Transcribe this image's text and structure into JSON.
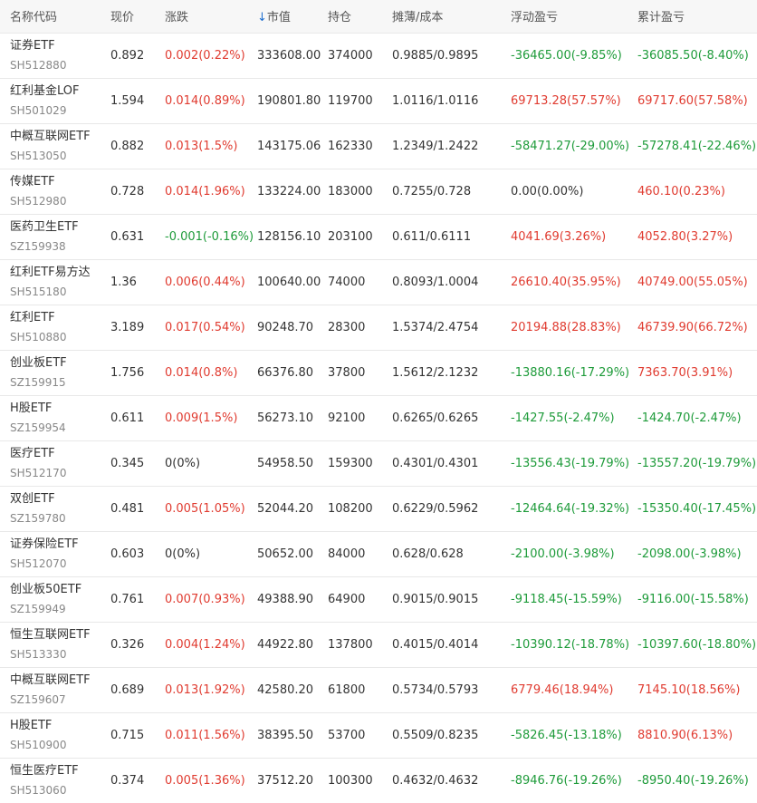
{
  "colors": {
    "up": "#e03b30",
    "down": "#1e9b3a",
    "flat": "#333333",
    "sort_arrow": "#1f6fd0"
  },
  "headers": {
    "name": "名称代码",
    "price": "现价",
    "change": "涨跌",
    "sort_arrow": "↓",
    "market_value": "市值",
    "position": "持仓",
    "cost": "摊薄/成本",
    "float_pl": "浮动盈亏",
    "total_pl": "累计盈亏"
  },
  "rows": [
    {
      "name": "证券ETF",
      "code": "SH512880",
      "price": "0.892",
      "change": "0.002(0.22%)",
      "change_dir": "up",
      "market_value": "333608.00",
      "position": "374000",
      "cost": "0.9885/0.9895",
      "float_pl": "-36465.00(-9.85%)",
      "float_dir": "down",
      "total_pl": "-36085.50(-8.40%)",
      "total_dir": "down"
    },
    {
      "name": "红利基金LOF",
      "code": "SH501029",
      "price": "1.594",
      "change": "0.014(0.89%)",
      "change_dir": "up",
      "market_value": "190801.80",
      "position": "119700",
      "cost": "1.0116/1.0116",
      "float_pl": "69713.28(57.57%)",
      "float_dir": "up",
      "total_pl": "69717.60(57.58%)",
      "total_dir": "up"
    },
    {
      "name": "中概互联网ETF",
      "code": "SH513050",
      "price": "0.882",
      "change": "0.013(1.5%)",
      "change_dir": "up",
      "market_value": "143175.06",
      "position": "162330",
      "cost": "1.2349/1.2422",
      "float_pl": "-58471.27(-29.00%)",
      "float_dir": "down",
      "total_pl": "-57278.41(-22.46%)",
      "total_dir": "down"
    },
    {
      "name": "传媒ETF",
      "code": "SH512980",
      "price": "0.728",
      "change": "0.014(1.96%)",
      "change_dir": "up",
      "market_value": "133224.00",
      "position": "183000",
      "cost": "0.7255/0.728",
      "float_pl": "0.00(0.00%)",
      "float_dir": "flat",
      "total_pl": "460.10(0.23%)",
      "total_dir": "up"
    },
    {
      "name": "医药卫生ETF",
      "code": "SZ159938",
      "price": "0.631",
      "change": "-0.001(-0.16%)",
      "change_dir": "down",
      "market_value": "128156.10",
      "position": "203100",
      "cost": "0.611/0.6111",
      "float_pl": "4041.69(3.26%)",
      "float_dir": "up",
      "total_pl": "4052.80(3.27%)",
      "total_dir": "up"
    },
    {
      "name": "红利ETF易方达",
      "code": "SH515180",
      "price": "1.36",
      "change": "0.006(0.44%)",
      "change_dir": "up",
      "market_value": "100640.00",
      "position": "74000",
      "cost": "0.8093/1.0004",
      "float_pl": "26610.40(35.95%)",
      "float_dir": "up",
      "total_pl": "40749.00(55.05%)",
      "total_dir": "up"
    },
    {
      "name": "红利ETF",
      "code": "SH510880",
      "price": "3.189",
      "change": "0.017(0.54%)",
      "change_dir": "up",
      "market_value": "90248.70",
      "position": "28300",
      "cost": "1.5374/2.4754",
      "float_pl": "20194.88(28.83%)",
      "float_dir": "up",
      "total_pl": "46739.90(66.72%)",
      "total_dir": "up"
    },
    {
      "name": "创业板ETF",
      "code": "SZ159915",
      "price": "1.756",
      "change": "0.014(0.8%)",
      "change_dir": "up",
      "market_value": "66376.80",
      "position": "37800",
      "cost": "1.5612/2.1232",
      "float_pl": "-13880.16(-17.29%)",
      "float_dir": "down",
      "total_pl": "7363.70(3.91%)",
      "total_dir": "up"
    },
    {
      "name": "H股ETF",
      "code": "SZ159954",
      "price": "0.611",
      "change": "0.009(1.5%)",
      "change_dir": "up",
      "market_value": "56273.10",
      "position": "92100",
      "cost": "0.6265/0.6265",
      "float_pl": "-1427.55(-2.47%)",
      "float_dir": "down",
      "total_pl": "-1424.70(-2.47%)",
      "total_dir": "down"
    },
    {
      "name": "医疗ETF",
      "code": "SH512170",
      "price": "0.345",
      "change": "0(0%)",
      "change_dir": "flat",
      "market_value": "54958.50",
      "position": "159300",
      "cost": "0.4301/0.4301",
      "float_pl": "-13556.43(-19.79%)",
      "float_dir": "down",
      "total_pl": "-13557.20(-19.79%)",
      "total_dir": "down"
    },
    {
      "name": "双创ETF",
      "code": "SZ159780",
      "price": "0.481",
      "change": "0.005(1.05%)",
      "change_dir": "up",
      "market_value": "52044.20",
      "position": "108200",
      "cost": "0.6229/0.5962",
      "float_pl": "-12464.64(-19.32%)",
      "float_dir": "down",
      "total_pl": "-15350.40(-17.45%)",
      "total_dir": "down"
    },
    {
      "name": "证券保险ETF",
      "code": "SH512070",
      "price": "0.603",
      "change": "0(0%)",
      "change_dir": "flat",
      "market_value": "50652.00",
      "position": "84000",
      "cost": "0.628/0.628",
      "float_pl": "-2100.00(-3.98%)",
      "float_dir": "down",
      "total_pl": "-2098.00(-3.98%)",
      "total_dir": "down"
    },
    {
      "name": "创业板50ETF",
      "code": "SZ159949",
      "price": "0.761",
      "change": "0.007(0.93%)",
      "change_dir": "up",
      "market_value": "49388.90",
      "position": "64900",
      "cost": "0.9015/0.9015",
      "float_pl": "-9118.45(-15.59%)",
      "float_dir": "down",
      "total_pl": "-9116.00(-15.58%)",
      "total_dir": "down"
    },
    {
      "name": "恒生互联网ETF",
      "code": "SH513330",
      "price": "0.326",
      "change": "0.004(1.24%)",
      "change_dir": "up",
      "market_value": "44922.80",
      "position": "137800",
      "cost": "0.4015/0.4014",
      "float_pl": "-10390.12(-18.78%)",
      "float_dir": "down",
      "total_pl": "-10397.60(-18.80%)",
      "total_dir": "down"
    },
    {
      "name": "中概互联网ETF",
      "code": "SZ159607",
      "price": "0.689",
      "change": "0.013(1.92%)",
      "change_dir": "up",
      "market_value": "42580.20",
      "position": "61800",
      "cost": "0.5734/0.5793",
      "float_pl": "6779.46(18.94%)",
      "float_dir": "up",
      "total_pl": "7145.10(18.56%)",
      "total_dir": "up"
    },
    {
      "name": "H股ETF",
      "code": "SH510900",
      "price": "0.715",
      "change": "0.011(1.56%)",
      "change_dir": "up",
      "market_value": "38395.50",
      "position": "53700",
      "cost": "0.5509/0.8235",
      "float_pl": "-5826.45(-13.18%)",
      "float_dir": "down",
      "total_pl": "8810.90(6.13%)",
      "total_dir": "up"
    },
    {
      "name": "恒生医疗ETF",
      "code": "SH513060",
      "price": "0.374",
      "change": "0.005(1.36%)",
      "change_dir": "up",
      "market_value": "37512.20",
      "position": "100300",
      "cost": "0.4632/0.4632",
      "float_pl": "-8946.76(-19.26%)",
      "float_dir": "down",
      "total_pl": "-8950.40(-19.26%)",
      "total_dir": "down"
    }
  ]
}
